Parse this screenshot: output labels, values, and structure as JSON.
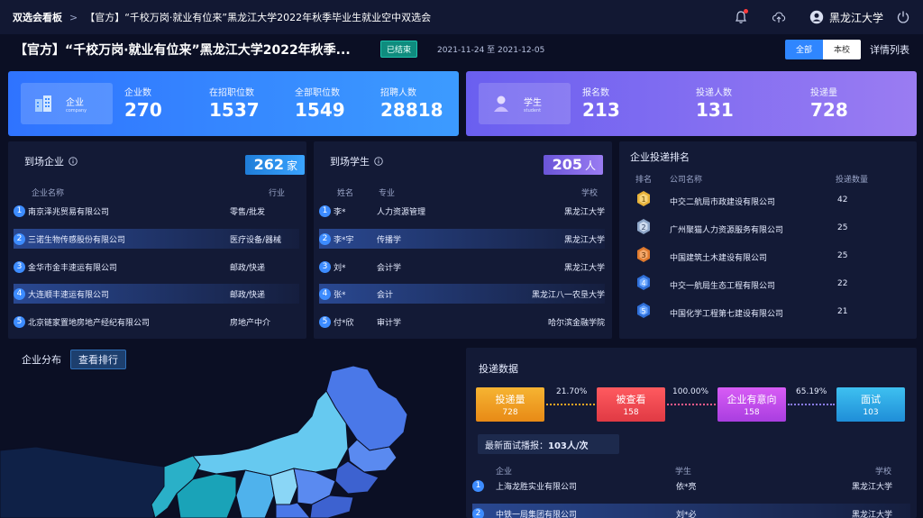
{
  "breadcrumb": {
    "root": "双选会看板",
    "separator": ">",
    "current": "【官方】“千校万岗·就业有位来”黑龙江大学2022年秋季毕业生就业空中双选会"
  },
  "topbar": {
    "school": "黑龙江大学"
  },
  "header": {
    "title": "【官方】“千校万岗·就业有位来”黑龙江大学2022年秋季...",
    "status": "已结束",
    "date_range": "2021-11-24 至 2021-12-05",
    "filter_all": "全部",
    "filter_school": "本校",
    "detail_link": "详情列表"
  },
  "enterprise_stats": {
    "tag_cn": "企业",
    "tag_en": "company",
    "items": [
      {
        "label": "企业数",
        "value": "270"
      },
      {
        "label": "在招职位数",
        "value": "1537"
      },
      {
        "label": "全部职位数",
        "value": "1549"
      },
      {
        "label": "招聘人数",
        "value": "28818"
      }
    ]
  },
  "student_stats": {
    "tag_cn": "学生",
    "tag_en": "student",
    "items": [
      {
        "label": "报名数",
        "value": "213"
      },
      {
        "label": "投递人数",
        "value": "131"
      },
      {
        "label": "投递量",
        "value": "728"
      }
    ]
  },
  "arrived_companies": {
    "title": "到场企业",
    "count": "262",
    "unit": "家",
    "col_name": "企业名称",
    "col_industry": "行业",
    "rows": [
      {
        "rank": "1",
        "name": "南京泽兆贸易有限公司",
        "industry": "零售/批发"
      },
      {
        "rank": "2",
        "name": "三诺生物传感股份有限公司",
        "industry": "医疗设备/器械"
      },
      {
        "rank": "3",
        "name": "金华市金丰速运有限公司",
        "industry": "邮政/快递"
      },
      {
        "rank": "4",
        "name": "大连顺丰速运有限公司",
        "industry": "邮政/快递"
      },
      {
        "rank": "5",
        "name": "北京链家置地房地产经纪有限公司",
        "industry": "房地产中介"
      }
    ]
  },
  "arrived_students": {
    "title": "到场学生",
    "count": "205",
    "unit": "人",
    "col_name": "姓名",
    "col_major": "专业",
    "col_school": "学校",
    "rows": [
      {
        "rank": "1",
        "name": "李*",
        "major": "人力资源管理",
        "school": "黑龙江大学"
      },
      {
        "rank": "2",
        "name": "李*宇",
        "major": "传播学",
        "school": "黑龙江大学"
      },
      {
        "rank": "3",
        "name": "刘*",
        "major": "会计学",
        "school": "黑龙江大学"
      },
      {
        "rank": "4",
        "name": "张*",
        "major": "会计",
        "school": "黑龙江八一农垦大学"
      },
      {
        "rank": "5",
        "name": "付*欣",
        "major": "审计学",
        "school": "哈尔滨金融学院"
      }
    ]
  },
  "delivery_ranking": {
    "title": "企业投递排名",
    "col_rank": "排名",
    "col_name": "公司名称",
    "col_count": "投递数量",
    "rows": [
      {
        "rank": "1",
        "name": "中交二航局市政建设有限公司",
        "count": "42"
      },
      {
        "rank": "2",
        "name": "广州聚猫人力资源服务有限公司",
        "count": "25"
      },
      {
        "rank": "3",
        "name": "中国建筑土木建设有限公司",
        "count": "25"
      },
      {
        "rank": "4",
        "name": "中交一航局生态工程有限公司",
        "count": "22"
      },
      {
        "rank": "5",
        "name": "中国化学工程第七建设有限公司",
        "count": "21"
      }
    ]
  },
  "distribution": {
    "title": "企业分布",
    "button": "查看排行"
  },
  "delivery_data": {
    "title": "投递数据",
    "steps": [
      {
        "label": "投递量",
        "value": "728"
      },
      {
        "label": "被查看",
        "value": "158"
      },
      {
        "label": "企业有意向",
        "value": "158"
      },
      {
        "label": "面试",
        "value": "103"
      }
    ],
    "rates": [
      "21.70%",
      "100.00%",
      "65.19%"
    ],
    "live_prefix": "最新面试播报：",
    "live_value": "103人/次",
    "col_company": "企业",
    "col_student": "学生",
    "col_school": "学校",
    "rows": [
      {
        "rank": "1",
        "company": "上海龙胜实业有限公司",
        "student": "依*亮",
        "school": "黑龙江大学"
      },
      {
        "rank": "2",
        "company": "中铁一局集团有限公司",
        "student": "刘*必",
        "school": "黑龙江大学"
      }
    ]
  },
  "colors": {
    "background": "#0b0f24",
    "panel": "#131a36",
    "accent_blue": "#2f86ff",
    "accent_purple": "#8a6ff0",
    "step_orange": "#f0a01e",
    "step_red": "#f04a52",
    "step_violet": "#c94df0",
    "step_cyan": "#2aa8e8"
  }
}
